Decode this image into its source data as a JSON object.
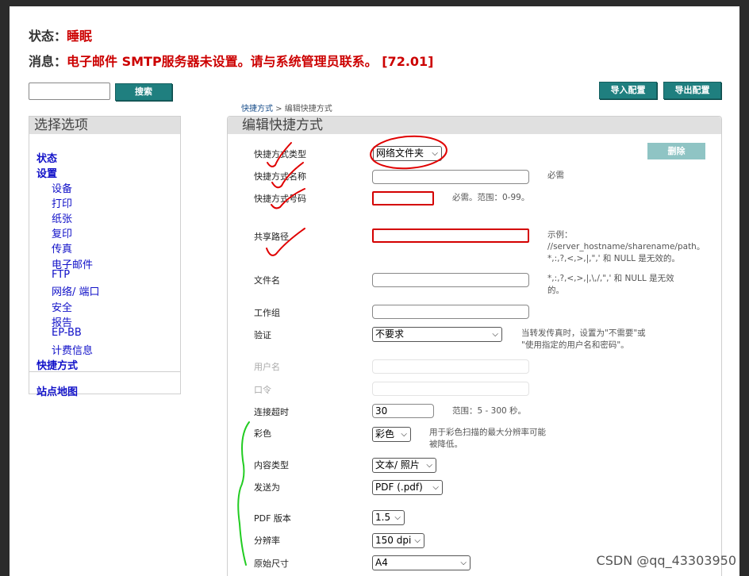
{
  "header": {
    "status_label": "状态：",
    "status_value": "睡眠",
    "message_label": "消息：",
    "message_value": "电子邮件 SMTP服务器未设置。请与系统管理员联系。 [72.01]"
  },
  "search": {
    "button_label": "搜索",
    "value": ""
  },
  "top_buttons": {
    "import_label": "导入配置",
    "export_label": "导出配置"
  },
  "breadcrumb": {
    "parent": "快捷方式",
    "separator": " > ",
    "current": "编辑快捷方式"
  },
  "sidebar": {
    "title": "选择选项",
    "items": [
      {
        "label": "状态"
      },
      {
        "label": "设置"
      },
      {
        "label": "设备"
      },
      {
        "label": "打印"
      },
      {
        "label": "纸张"
      },
      {
        "label": "复印"
      },
      {
        "label": "传真"
      },
      {
        "label": "电子邮件"
      },
      {
        "label": "FTP"
      },
      {
        "label": "网络/ 端口"
      },
      {
        "label": "安全"
      },
      {
        "label": "报告"
      },
      {
        "label": "EP-BB"
      },
      {
        "label": "计费信息"
      },
      {
        "label": "快捷方式"
      },
      {
        "label": "站点地图"
      }
    ]
  },
  "form": {
    "title": "编辑快捷方式",
    "delete_label": "删除",
    "shortcut_type": {
      "label": "快捷方式类型",
      "value": "网络文件夹"
    },
    "shortcut_name": {
      "label": "快捷方式名称",
      "value": "",
      "hint": "必需"
    },
    "shortcut_number": {
      "label": "快捷方式号码",
      "value": "",
      "hint": "必需。范围：0-99。"
    },
    "share_path": {
      "label": "共享路径",
      "value": "",
      "hint_line1": "示例：",
      "hint_line2": "//server_hostname/sharename/path。",
      "hint_line3": "*,:,?,<,>,|,\",' 和 NULL 是无效的。"
    },
    "file_name": {
      "label": "文件名",
      "value": "",
      "hint_line1": "*,:,?,<,>,|,\\,/,\",' 和 NULL 是无效",
      "hint_line2": "的。"
    },
    "workgroup": {
      "label": "工作组",
      "value": ""
    },
    "auth": {
      "label": "验证",
      "value": "不要求",
      "hint_line1": "当转发传真时，设置为\"不需要\"或",
      "hint_line2": "\"使用指定的用户名和密码\"。"
    },
    "username": {
      "label": "用户名",
      "value": ""
    },
    "password": {
      "label": "口令",
      "value": ""
    },
    "timeout": {
      "label": "连接超时",
      "value": "30",
      "hint": "范围：5 - 300 秒。"
    },
    "color": {
      "label": "彩色",
      "value": "彩色",
      "hint_line1": "用于彩色扫描的最大分辨率可能",
      "hint_line2": "被降低。"
    },
    "content_type": {
      "label": "内容类型",
      "value": "文本/ 照片"
    },
    "send_as": {
      "label": "发送为",
      "value": "PDF (.pdf)"
    },
    "pdf_version": {
      "label": "PDF 版本",
      "value": "1.5"
    },
    "resolution": {
      "label": "分辨率",
      "value": "150 dpi"
    },
    "original_size": {
      "label": "原始尺寸",
      "value": "A4"
    }
  },
  "watermark": "CSDN @qq_43303950",
  "colors": {
    "accent": "#1f7f7f",
    "error": "#cc0000",
    "link": "#1010c8",
    "annotation_red": "#e00000",
    "annotation_green": "#22cc22"
  }
}
